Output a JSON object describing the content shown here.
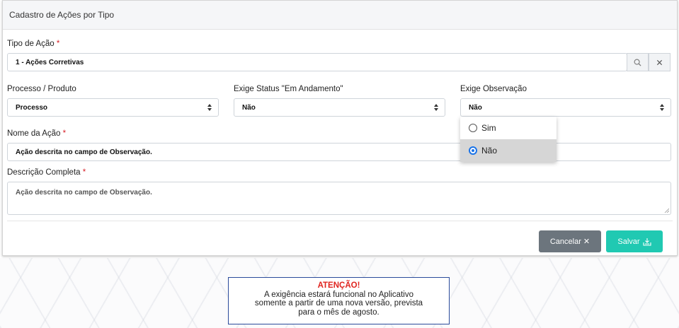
{
  "modal": {
    "title": "Cadastro de Ações por Tipo"
  },
  "form": {
    "tipo_acao": {
      "label": "Tipo de Ação",
      "required": "*",
      "value": "1 - Ações Corretivas"
    },
    "processo_produto": {
      "label": "Processo / Produto",
      "value": "Processo"
    },
    "exige_status": {
      "label": "Exige Status \"Em Andamento\"",
      "value": "Não"
    },
    "exige_observacao": {
      "label": "Exige Observação",
      "value": "Não",
      "options": [
        {
          "label": "Sim",
          "checked": false
        },
        {
          "label": "Não",
          "checked": true
        }
      ]
    },
    "nome_acao": {
      "label": "Nome da Ação",
      "required": "*",
      "value": "Ação descrita no campo de Observação."
    },
    "descricao": {
      "label": "Descrição Completa",
      "required": "*",
      "value": "Ação descrita no campo de Observação."
    }
  },
  "footer": {
    "cancel_label": "Cancelar ✕",
    "save_label": "Salvar"
  },
  "notice": {
    "title": "ATENÇÃO!",
    "line1": "A exigência estará funcional no Aplicativo",
    "line2": "somente a partir de uma nova versão, prevista",
    "line3": "para o mês de agosto."
  },
  "colors": {
    "save": "#20c9b2",
    "cancel": "#6c757d",
    "required": "#d8232a",
    "notice_border": "#2a4a9a"
  },
  "icons": {
    "search": "search-icon",
    "clear": "close-icon",
    "save": "save-icon"
  }
}
